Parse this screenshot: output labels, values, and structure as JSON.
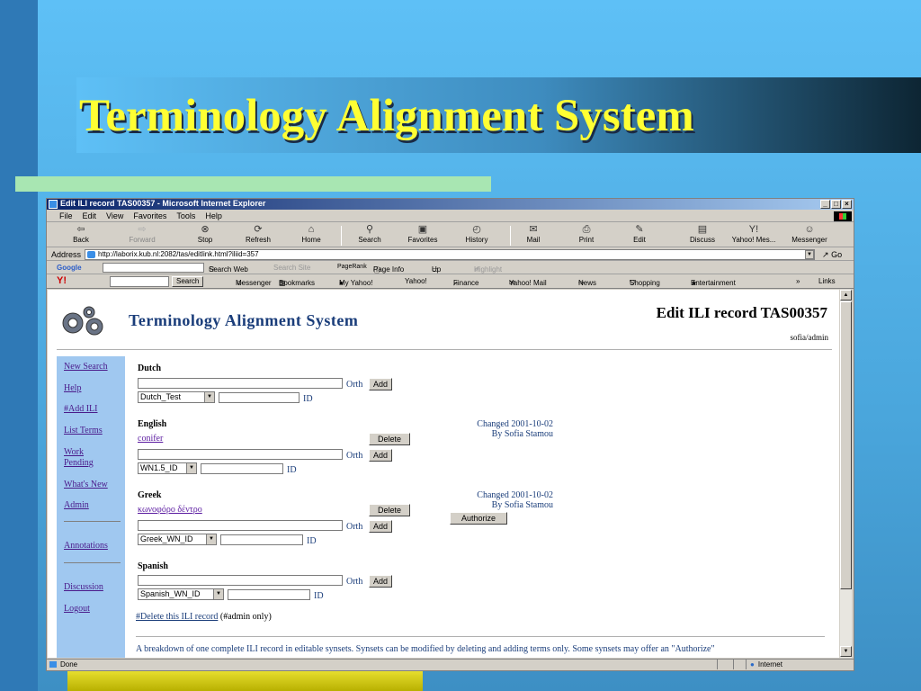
{
  "slide": {
    "title": "Terminology Alignment System"
  },
  "browser": {
    "window_title": "Edit ILI record TAS00357 - Microsoft Internet Explorer",
    "menu": [
      "File",
      "Edit",
      "View",
      "Favorites",
      "Tools",
      "Help"
    ],
    "toolbar": [
      {
        "label": "Back",
        "icon": "back-arrow-icon"
      },
      {
        "label": "Forward",
        "icon": "forward-arrow-icon"
      },
      {
        "label": "Stop",
        "icon": "stop-icon"
      },
      {
        "label": "Refresh",
        "icon": "refresh-icon"
      },
      {
        "label": "Home",
        "icon": "home-icon"
      },
      {
        "label": "Search",
        "icon": "search-icon"
      },
      {
        "label": "Favorites",
        "icon": "favorites-icon"
      },
      {
        "label": "History",
        "icon": "history-icon"
      },
      {
        "label": "Mail",
        "icon": "mail-icon"
      },
      {
        "label": "Print",
        "icon": "print-icon"
      },
      {
        "label": "Edit",
        "icon": "edit-icon"
      },
      {
        "label": "Discuss",
        "icon": "discuss-icon"
      },
      {
        "label": "Yahoo! Mes...",
        "icon": "yahoo-messenger-icon"
      },
      {
        "label": "Messenger",
        "icon": "messenger-icon"
      }
    ],
    "address_label": "Address",
    "url": "http://laborix.kub.nl:2082/tas/editlink.html?iliid=357",
    "go_label": "Go",
    "google_bar": {
      "logo": "Google",
      "search_web": "Search Web",
      "search_site": "Search Site",
      "pagerank": "PageRank",
      "page_info": "Page Info",
      "up": "Up",
      "highlight": "Highlight"
    },
    "yahoo_bar": {
      "search_button": "Search",
      "items": [
        "Messenger",
        "Bookmarks",
        "My Yahoo!",
        "Yahoo!",
        "Finance",
        "Yahoo! Mail",
        "News",
        "Shopping",
        "Entertainment"
      ],
      "links": "Links"
    },
    "status": {
      "text": "Done",
      "zone": "Internet"
    }
  },
  "page": {
    "site_title": "Terminology Alignment System",
    "record_title": "Edit ILI record TAS00357",
    "user": "sofia/admin",
    "sidebar": [
      "New Search",
      "Help",
      "#Add ILI",
      "List Terms",
      "Work Pending",
      "What's New",
      "Admin",
      "Annotations",
      "Discussion",
      "Logout"
    ],
    "orth_label": "Orth",
    "id_label": "ID",
    "add_label": "Add",
    "delete_label": "Delete",
    "authorize_label": "Authorize",
    "sections": [
      {
        "language": "Dutch",
        "select": "Dutch_Test"
      },
      {
        "language": "English",
        "term": "conifer",
        "changed": "Changed 2001-10-02",
        "by": "By Sofia Stamou",
        "select": "WN1.5_ID"
      },
      {
        "language": "Greek",
        "term": "κωνοφόρο δέντρο",
        "changed": "Changed 2001-10-02",
        "by": "By Sofia Stamou",
        "select": "Greek_WN_ID"
      },
      {
        "language": "Spanish",
        "select": "Spanish_WN_ID"
      }
    ],
    "delete_link": "#Delete this ILI record",
    "delete_note": " (#admin only)",
    "breakdown": "A breakdown of one complete ILI record in editable synsets. Synsets can be modified by deleting and adding terms only. Some synsets may offer an \"Authorize\""
  }
}
